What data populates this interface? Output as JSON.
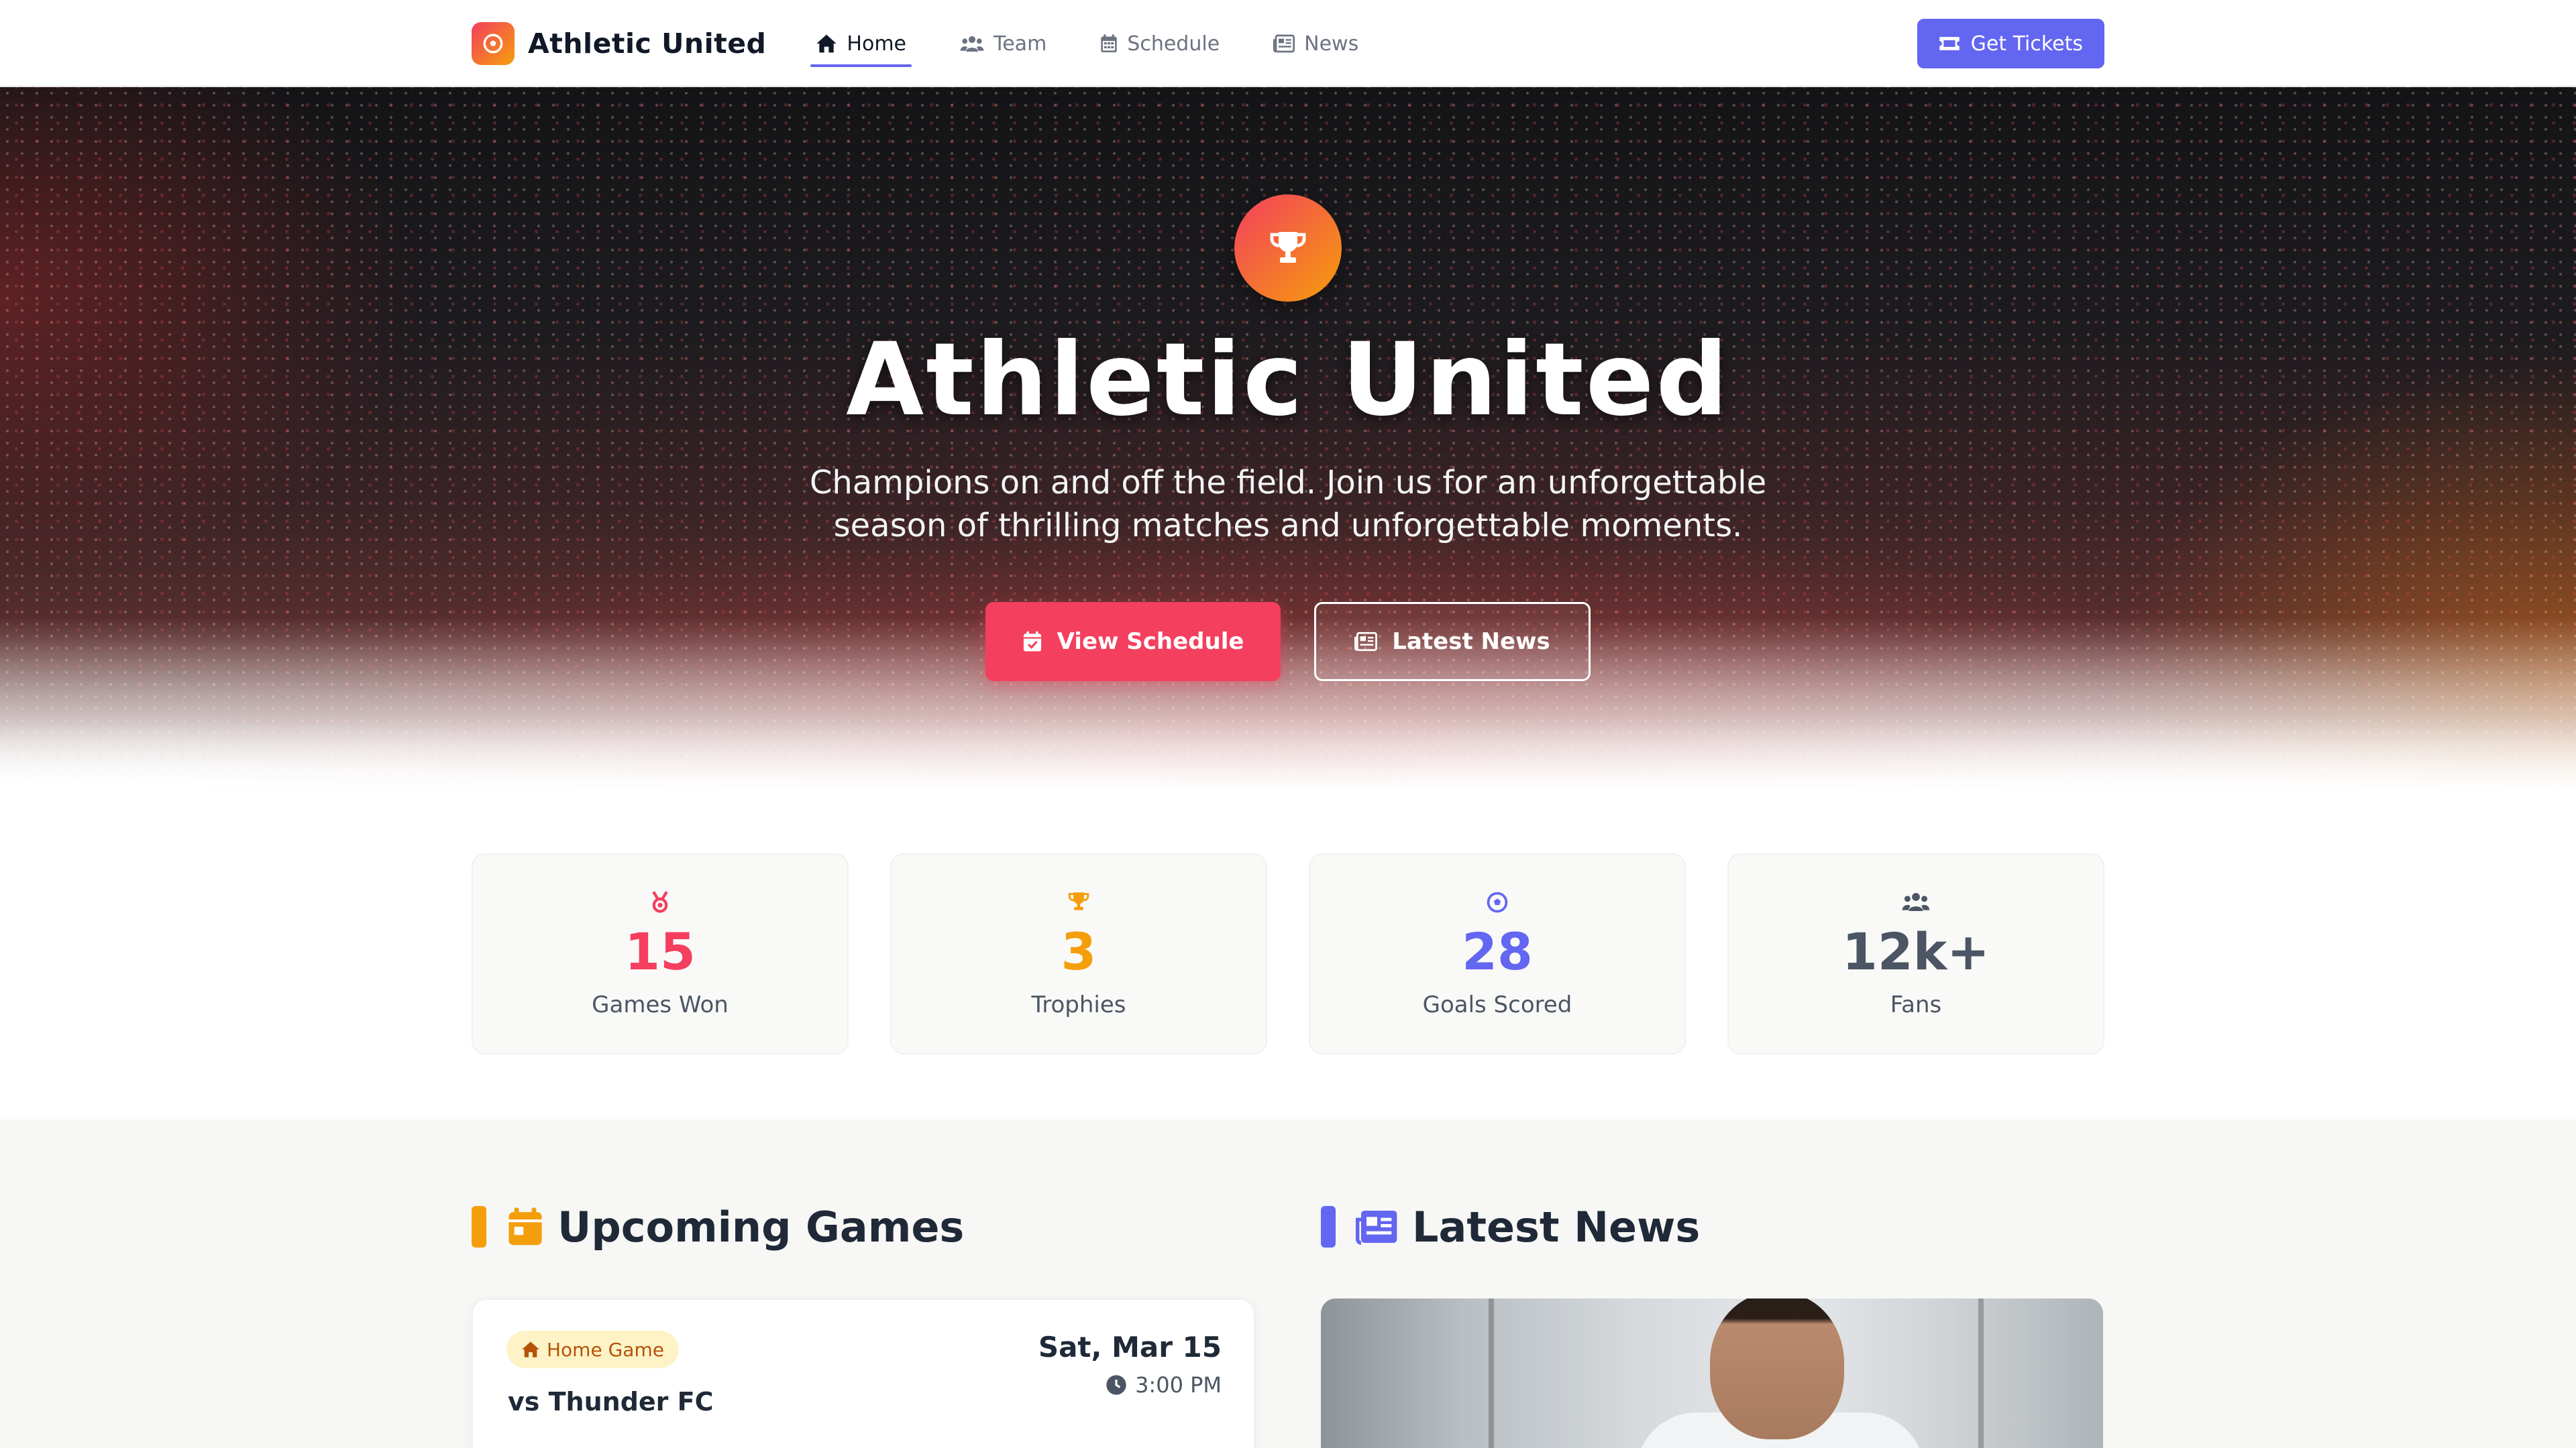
{
  "colors": {
    "primary": "#6366f1",
    "rose": "#f43f5e",
    "amber": "#f59e0b",
    "indigo": "#6366f1",
    "slate": "#4b5563"
  },
  "nav": {
    "brand": "Athletic United",
    "brand_icon": "soccer-ball-icon",
    "links": [
      {
        "label": "Home",
        "icon": "home-icon",
        "active": true
      },
      {
        "label": "Team",
        "icon": "users-icon",
        "active": false
      },
      {
        "label": "Schedule",
        "icon": "calendar-icon",
        "active": false
      },
      {
        "label": "News",
        "icon": "newspaper-icon",
        "active": false
      }
    ],
    "cta": {
      "label": "Get Tickets",
      "icon": "ticket-icon"
    }
  },
  "hero": {
    "icon": "trophy-icon",
    "title": "Athletic United",
    "subtitle": "Champions on and off the field. Join us for an unforgettable season of thrilling matches and unforgettable moments.",
    "primary_button": {
      "label": "View Schedule",
      "icon": "calendar-check-icon"
    },
    "secondary_button": {
      "label": "Latest News",
      "icon": "newspaper-icon"
    }
  },
  "stats": [
    {
      "value": "15",
      "label": "Games Won",
      "icon": "medal-icon",
      "color": "#f43f5e"
    },
    {
      "value": "3",
      "label": "Trophies",
      "icon": "trophy-icon",
      "color": "#f59e0b"
    },
    {
      "value": "28",
      "label": "Goals Scored",
      "icon": "soccer-ball-icon",
      "color": "#6366f1"
    },
    {
      "value": "12k+",
      "label": "Fans",
      "icon": "users-icon",
      "color": "#4b5563"
    }
  ],
  "upcoming": {
    "title": "Upcoming Games",
    "icon": "calendar-icon",
    "games": [
      {
        "badge": "Home Game",
        "opponent": "vs Thunder FC",
        "date": "Sat, Mar 15",
        "time": "3:00 PM"
      }
    ]
  },
  "news": {
    "title": "Latest News",
    "icon": "newspaper-icon"
  }
}
